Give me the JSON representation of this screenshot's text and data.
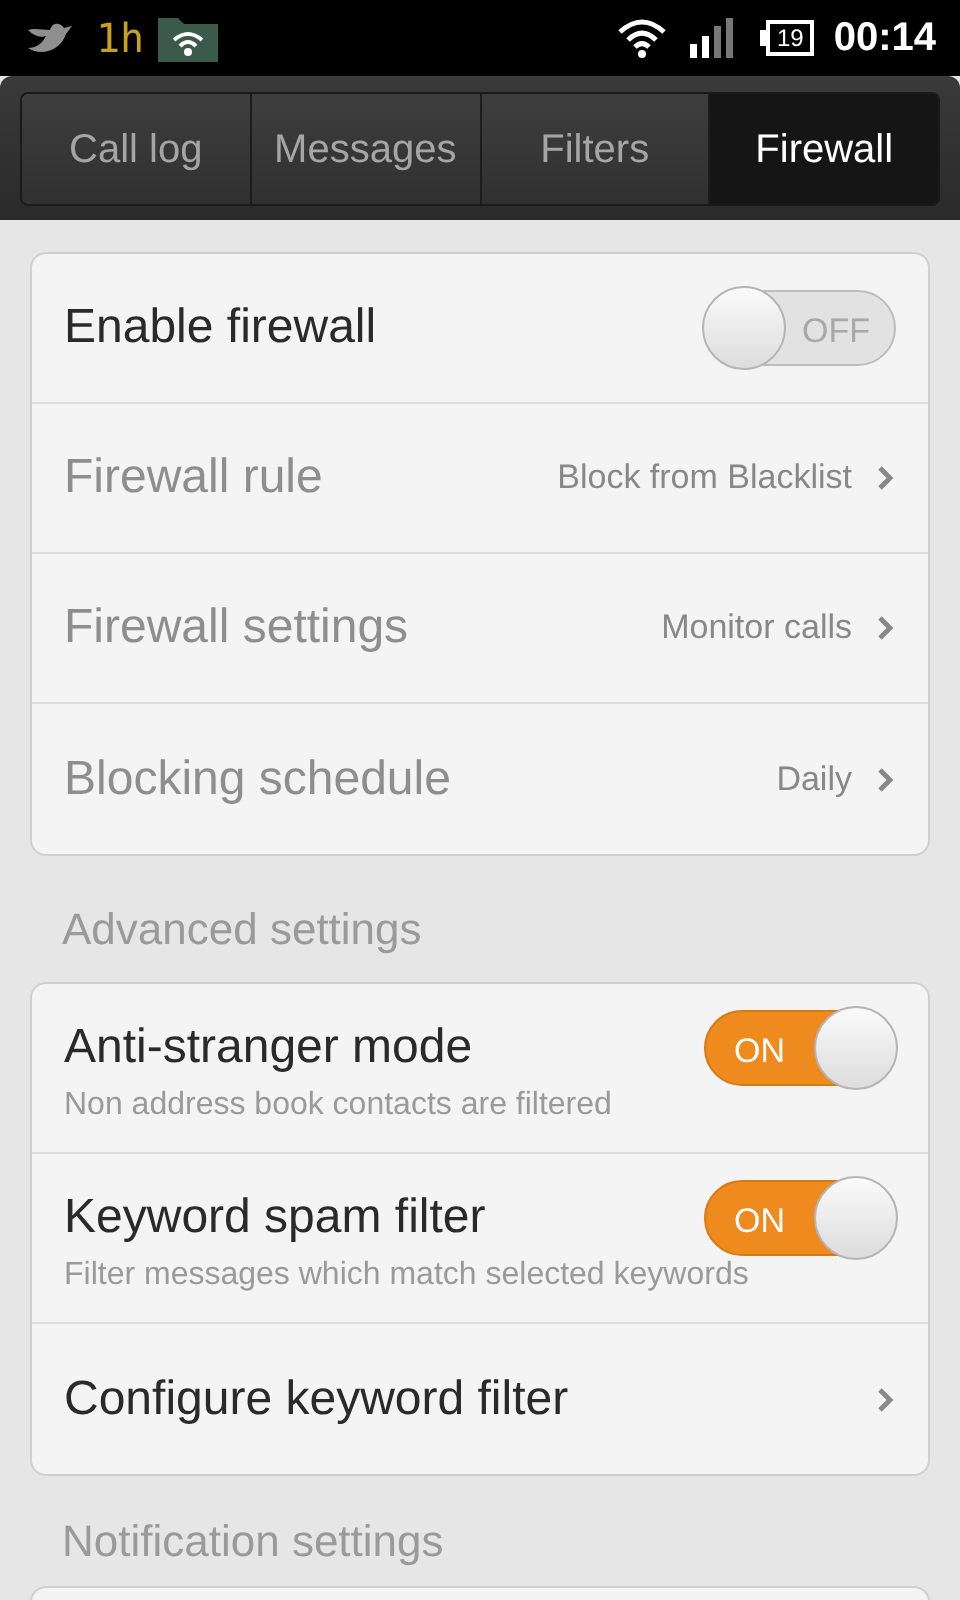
{
  "status_bar": {
    "notification_text": "1h",
    "battery": "19",
    "time": "00:14"
  },
  "tabs": [
    {
      "label": "Call log",
      "selected": false
    },
    {
      "label": "Messages",
      "selected": false
    },
    {
      "label": "Filters",
      "selected": false
    },
    {
      "label": "Firewall",
      "selected": true
    }
  ],
  "firewall": {
    "rows": [
      {
        "kind": "toggle",
        "label": "Enable firewall",
        "on": false,
        "toggle_text": "OFF",
        "disabled": false
      },
      {
        "kind": "link",
        "label": "Firewall rule",
        "value": "Block from Blacklist",
        "disabled": true
      },
      {
        "kind": "link",
        "label": "Firewall settings",
        "value": "Monitor calls",
        "disabled": true
      },
      {
        "kind": "link",
        "label": "Blocking schedule",
        "value": "Daily",
        "disabled": true
      }
    ]
  },
  "advanced": {
    "heading": "Advanced settings",
    "rows": [
      {
        "kind": "toggle",
        "label": "Anti-stranger mode",
        "description": "Non address book contacts are filtered",
        "on": true,
        "toggle_text": "ON",
        "disabled": false
      },
      {
        "kind": "toggle",
        "label": "Keyword spam filter",
        "description": "Filter messages which match selected keywords",
        "on": true,
        "toggle_text": "ON",
        "disabled": false
      },
      {
        "kind": "link",
        "label": "Configure keyword filter",
        "disabled": false
      }
    ]
  },
  "notification": {
    "heading": "Notification settings"
  }
}
